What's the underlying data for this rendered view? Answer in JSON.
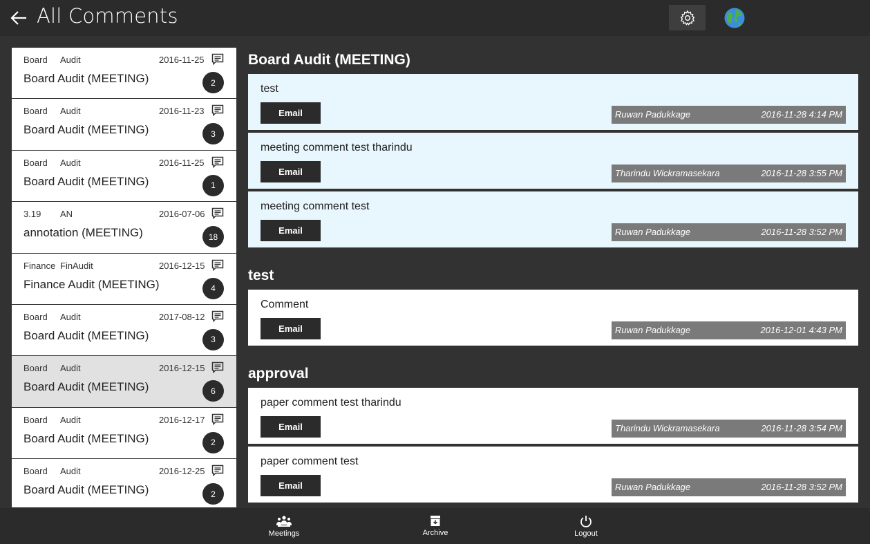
{
  "header": {
    "title": "All Comments",
    "back_icon": "back-arrow-icon",
    "settings_icon": "gear-icon",
    "globe_icon": "globe-icon"
  },
  "list": {
    "items": [
      {
        "category": "Board",
        "subcategory": "Audit",
        "date": "2016-11-25",
        "title": "Board Audit (MEETING)",
        "count": "2",
        "selected": false
      },
      {
        "category": "Board",
        "subcategory": "Audit",
        "date": "2016-11-23",
        "title": "Board Audit (MEETING)",
        "count": "3",
        "selected": false
      },
      {
        "category": "Board",
        "subcategory": "Audit",
        "date": "2016-11-25",
        "title": "Board Audit (MEETING)",
        "count": "1",
        "selected": false
      },
      {
        "category": "3.19",
        "subcategory": "AN",
        "date": "2016-07-06",
        "title": "annotation (MEETING)",
        "count": "18",
        "selected": false
      },
      {
        "category": "Finance",
        "subcategory": "FinAudit",
        "date": "2016-12-15",
        "title": "Finance Audit (MEETING)",
        "count": "4",
        "selected": false
      },
      {
        "category": "Board",
        "subcategory": "Audit",
        "date": "2017-08-12",
        "title": "Board Audit (MEETING)",
        "count": "3",
        "selected": false
      },
      {
        "category": "Board",
        "subcategory": "Audit",
        "date": "2016-12-15",
        "title": "Board Audit (MEETING)",
        "count": "6",
        "selected": true
      },
      {
        "category": "Board",
        "subcategory": "Audit",
        "date": "2016-12-17",
        "title": "Board Audit (MEETING)",
        "count": "2",
        "selected": false
      },
      {
        "category": "Board",
        "subcategory": "Audit",
        "date": "2016-12-25",
        "title": "Board Audit (MEETING)",
        "count": "2",
        "selected": false
      }
    ]
  },
  "groups": [
    {
      "title": "Board Audit (MEETING)",
      "highlight": true,
      "comments": [
        {
          "text": "test",
          "email_label": "Email",
          "author": "Ruwan Padukkage",
          "date": "2016-11-28 4:14 PM"
        },
        {
          "text": "meeting comment test tharindu",
          "email_label": "Email",
          "author": "Tharindu Wickramasekara",
          "date": "2016-11-28 3:55 PM"
        },
        {
          "text": "meeting comment test",
          "email_label": "Email",
          "author": "Ruwan Padukkage",
          "date": "2016-11-28 3:52 PM"
        }
      ]
    },
    {
      "title": "test",
      "highlight": false,
      "comments": [
        {
          "text": "Comment",
          "email_label": "Email",
          "author": "Ruwan Padukkage",
          "date": "2016-12-01 4:43 PM"
        }
      ]
    },
    {
      "title": "approval",
      "highlight": false,
      "comments": [
        {
          "text": "paper comment test tharindu",
          "email_label": "Email",
          "author": "Tharindu Wickramasekara",
          "date": "2016-11-28 3:54 PM"
        },
        {
          "text": "paper comment test",
          "email_label": "Email",
          "author": "Ruwan Padukkage",
          "date": "2016-11-28 3:52 PM"
        }
      ]
    }
  ],
  "bottom_nav": {
    "meetings_label": "Meetings",
    "archive_label": "Archive",
    "logout_label": "Logout"
  },
  "colors": {
    "background": "#333232",
    "bar": "#2b2b2b",
    "highlight_card": "#e8f6fd",
    "meta_bar": "#7a7a7a",
    "selected_item": "#e1e1e1"
  }
}
